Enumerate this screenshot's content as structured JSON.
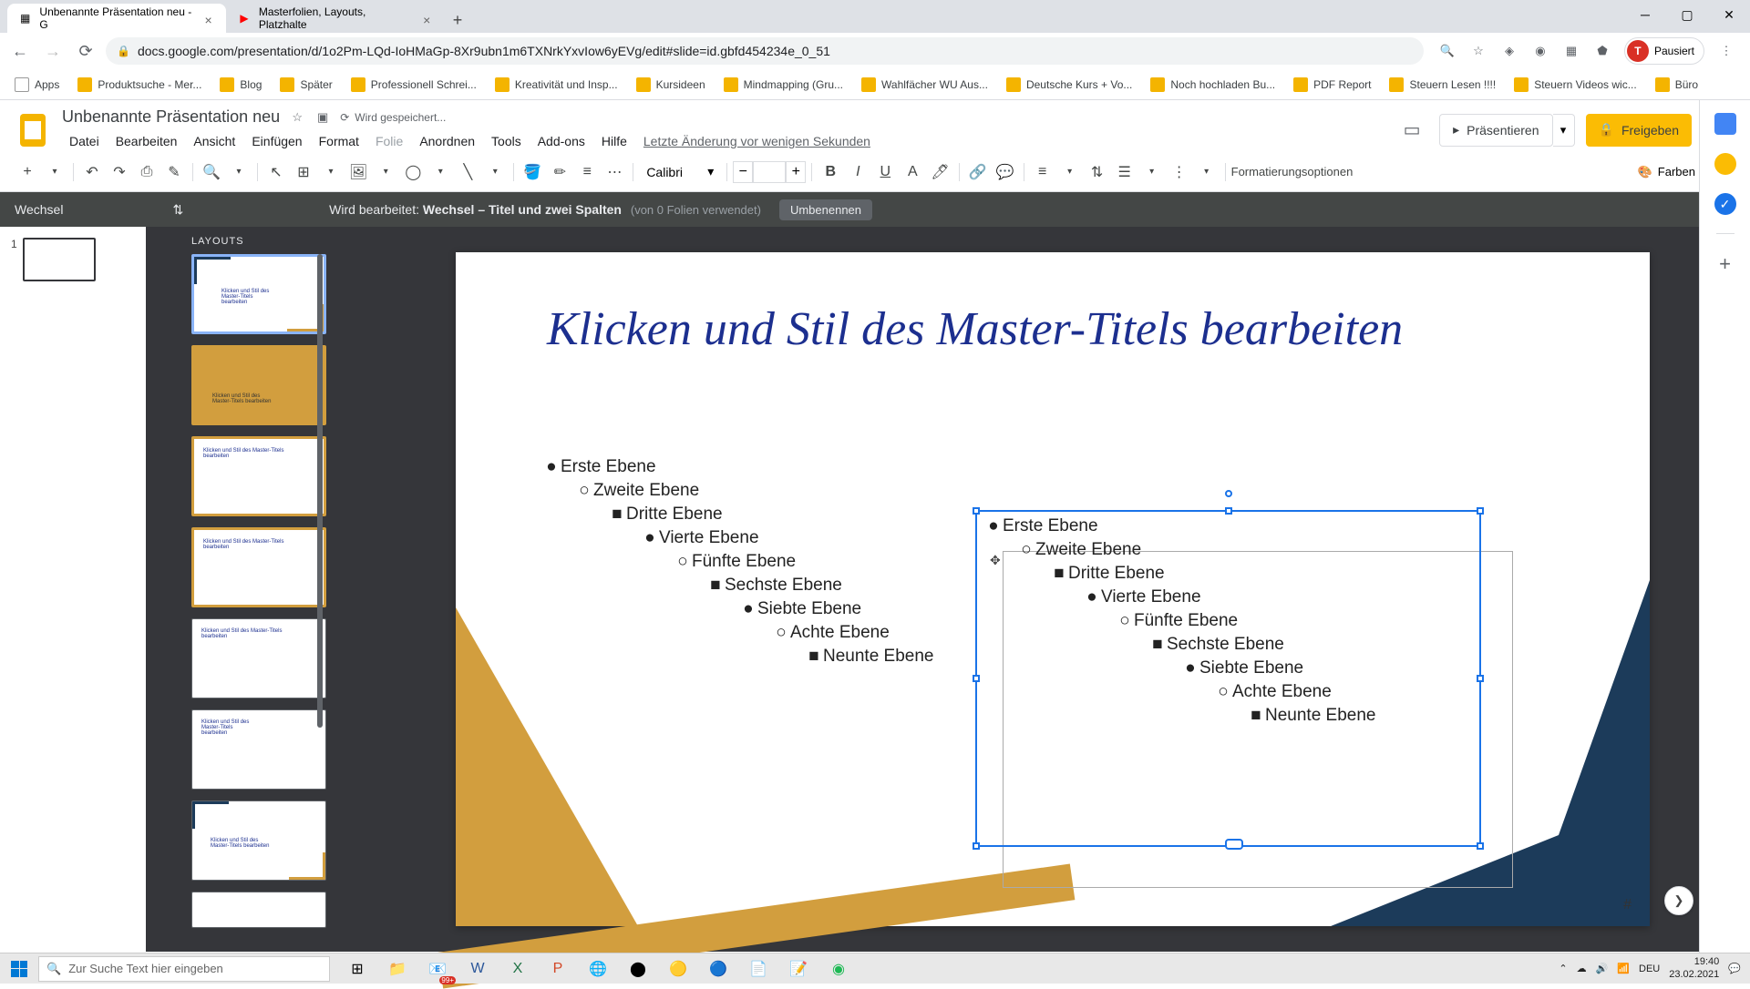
{
  "browser": {
    "tabs": [
      {
        "title": "Unbenannte Präsentation neu - G",
        "icon_color": "#f4b400"
      },
      {
        "title": "Masterfolien, Layouts, Platzhalte",
        "icon_color": "#f00"
      }
    ],
    "url": "docs.google.com/presentation/d/1o2Pm-LQd-IoHMaGp-8Xr9ubn1m6TXNrkYxvIow6yEVg/edit#slide=id.gbfd454234e_0_51",
    "profile_status": "Pausiert",
    "bookmarks": [
      "Apps",
      "Produktsuche - Mer...",
      "Blog",
      "Später",
      "Professionell Schrei...",
      "Kreativität und Insp...",
      "Kursideen",
      "Mindmapping (Gru...",
      "Wahlfächer WU Aus...",
      "Deutsche Kurs + Vo...",
      "Noch hochladen Bu...",
      "PDF Report",
      "Steuern Lesen !!!!",
      "Steuern Videos wic...",
      "Büro"
    ]
  },
  "app": {
    "doc_title": "Unbenannte Präsentation neu",
    "save_status": "Wird gespeichert...",
    "menus": [
      "Datei",
      "Bearbeiten",
      "Ansicht",
      "Einfügen",
      "Format",
      "Folie",
      "Anordnen",
      "Tools",
      "Add-ons",
      "Hilfe"
    ],
    "last_edit": "Letzte Änderung vor wenigen Sekunden",
    "present_label": "Präsentieren",
    "share_label": "Freigeben"
  },
  "toolbar": {
    "font": "Calibri",
    "font_size": "",
    "format_options": "Formatierungsoptionen",
    "colors": "Farben"
  },
  "master": {
    "theme_name": "Wechsel",
    "editing_prefix": "Wird bearbeitet:",
    "editing_label": "Wechsel – Titel und zwei Spalten",
    "usage": "(von 0 Folien verwendet)",
    "rename": "Umbenennen",
    "layouts_label": "LAYOUTS"
  },
  "slide": {
    "title": "Klicken und Stil des Master-Titels bearbeiten",
    "levels": [
      "Erste Ebene",
      "Zweite Ebene",
      "Dritte Ebene",
      "Vierte Ebene",
      "Fünfte Ebene",
      "Sechste Ebene",
      "Siebte Ebene",
      "Achte Ebene",
      "Neunte Ebene"
    ],
    "page_num": "#"
  },
  "taskbar": {
    "search_placeholder": "Zur Suche Text hier eingeben",
    "lang": "DEU",
    "time": "19:40",
    "date": "23.02.2021",
    "notif_count": "99+"
  }
}
